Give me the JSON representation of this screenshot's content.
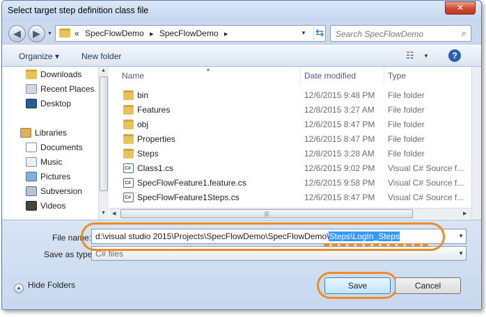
{
  "window": {
    "title": "Select target step definition class file",
    "close_glyph": "✕"
  },
  "nav": {
    "back_glyph": "◀",
    "forward_glyph": "▶",
    "breadcrumb": [
      "«",
      "SpecFlowDemo",
      "SpecFlowDemo"
    ],
    "search_placeholder": "Search SpecFlowDemo"
  },
  "toolbar": {
    "organize_label": "Organize ▾",
    "new_folder_label": "New folder",
    "help_label": "?"
  },
  "sidebar": {
    "favorites": [
      {
        "label": "Downloads",
        "icon": "downloads-folder-icon"
      },
      {
        "label": "Recent Places",
        "icon": "recent-places-icon"
      },
      {
        "label": "Desktop",
        "icon": "desktop-icon"
      }
    ],
    "libraries_label": "Libraries",
    "libraries": [
      {
        "label": "Documents",
        "icon": "documents-icon"
      },
      {
        "label": "Music",
        "icon": "music-icon"
      },
      {
        "label": "Pictures",
        "icon": "pictures-icon"
      },
      {
        "label": "Subversion",
        "icon": "subversion-icon"
      },
      {
        "label": "Videos",
        "icon": "videos-icon"
      }
    ]
  },
  "files": {
    "columns": {
      "name": "Name",
      "date": "Date modified",
      "type": "Type"
    },
    "rows": [
      {
        "name": "bin",
        "date": "12/6/2015 9:48 PM",
        "type": "File folder",
        "icon": "folder-icon"
      },
      {
        "name": "Features",
        "date": "12/8/2015 3:27 AM",
        "type": "File folder",
        "icon": "folder-icon"
      },
      {
        "name": "obj",
        "date": "12/6/2015 8:47 PM",
        "type": "File folder",
        "icon": "folder-icon"
      },
      {
        "name": "Properties",
        "date": "12/6/2015 8:47 PM",
        "type": "File folder",
        "icon": "folder-icon"
      },
      {
        "name": "Steps",
        "date": "12/8/2015 3:28 AM",
        "type": "File folder",
        "icon": "folder-icon"
      },
      {
        "name": "Class1.cs",
        "date": "12/6/2015 9:02 PM",
        "type": "Visual C# Source f...",
        "icon": "csharp-file-icon"
      },
      {
        "name": "SpecFlowFeature1.feature.cs",
        "date": "12/6/2015 9:58 PM",
        "type": "Visual C# Source f...",
        "icon": "csharp-file-icon"
      },
      {
        "name": "SpecFlowFeature1Steps.cs",
        "date": "12/6/2015 8:47 PM",
        "type": "Visual C# Source f...",
        "icon": "csharp-file-icon"
      }
    ]
  },
  "form": {
    "file_name_label": "File name:",
    "file_name_prefix": "d:\\visual studio 2015\\Projects\\SpecFlowDemo\\SpecFlowDemo\\",
    "file_name_selected": "Steps\\LogIn_Steps",
    "save_as_type_label": "Save as type:",
    "save_as_type_value": "C# files"
  },
  "footer": {
    "hide_folders_label": "Hide Folders",
    "save_label": "Save",
    "cancel_label": "Cancel"
  },
  "colors": {
    "highlight": "#f08b24",
    "selection": "#3399ff"
  }
}
